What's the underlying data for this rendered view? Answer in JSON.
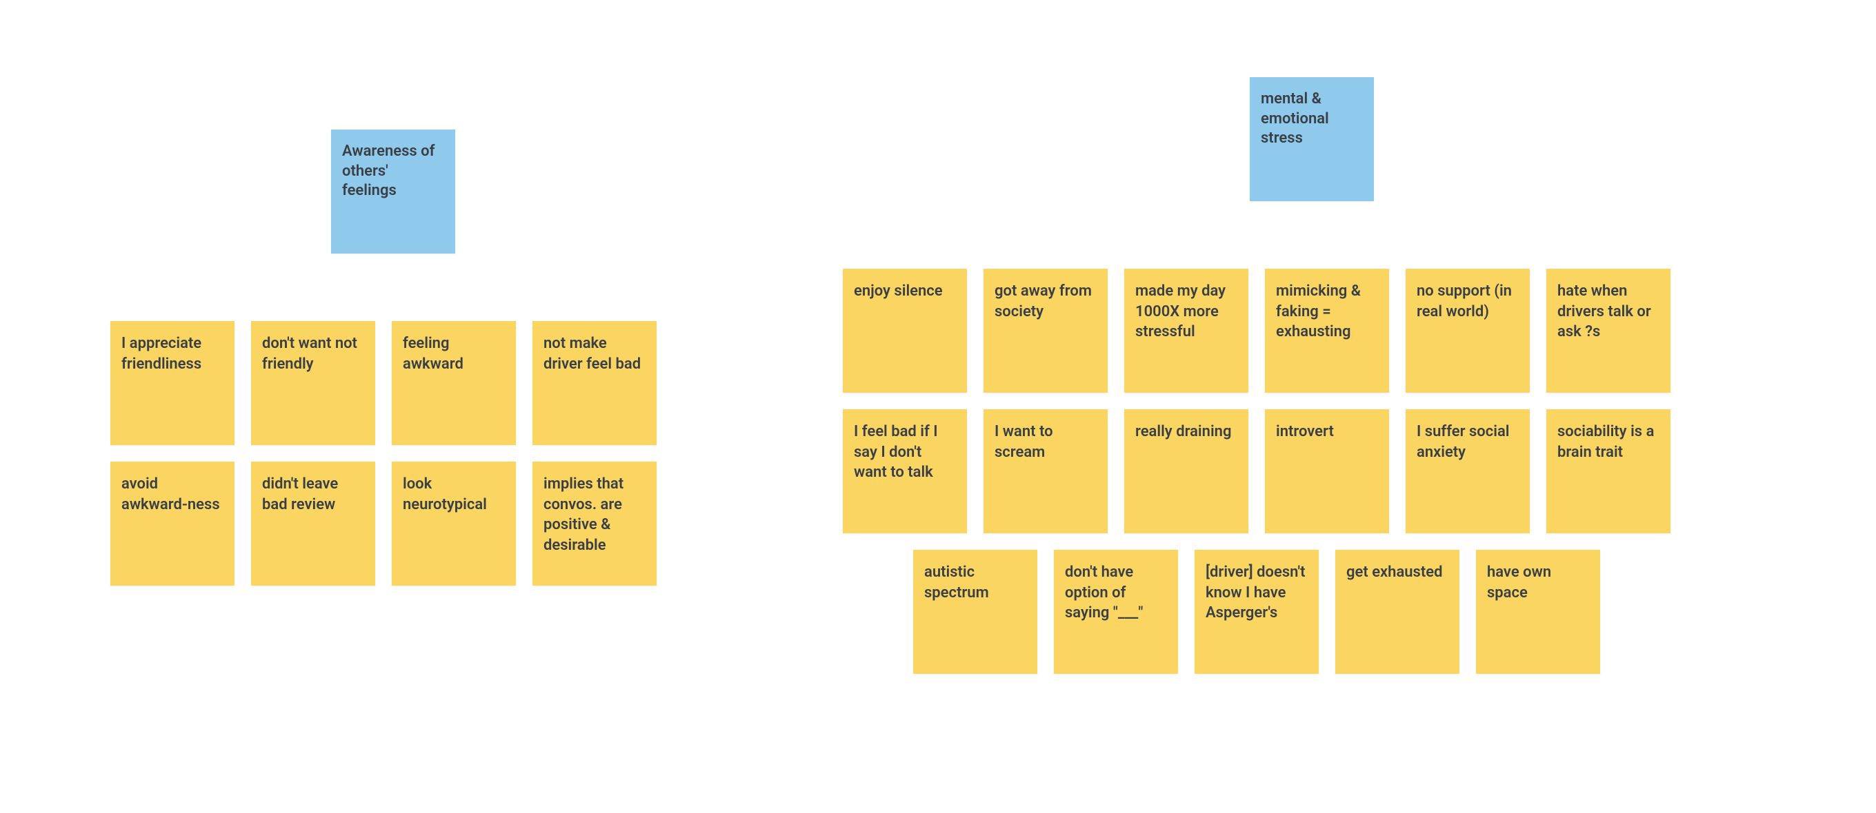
{
  "colors": {
    "header": "#8fc9eb",
    "note": "#fad561",
    "text": "#3a3f46",
    "background": "#ffffff"
  },
  "clusters": [
    {
      "id": "awareness",
      "header": "Awareness of others' feelings",
      "rows": [
        [
          "I appreciate friendliness",
          "don't want not friendly",
          "feeling awkward",
          "not make driver feel bad"
        ],
        [
          "avoid awkward-ness",
          "didn't leave bad review",
          "look neurotypical",
          "implies that convos. are positive & desirable"
        ]
      ]
    },
    {
      "id": "stress",
      "header": "mental & emotional stress",
      "rows": [
        [
          "enjoy silence",
          "got away from society",
          "made my day 1000X more stressful",
          "mimicking & faking = exhausting",
          "no support (in real world)",
          "hate when drivers talk or ask ?s"
        ],
        [
          "I feel bad if I say I don't want to talk",
          "I want to scream",
          "really draining",
          "introvert",
          "I suffer social anxiety",
          "sociability is a brain trait"
        ],
        [
          "autistic spectrum",
          "don't have option of saying \"___\"",
          "[driver] doesn't know I have Asperger's",
          "get exhausted",
          "have own space"
        ]
      ]
    }
  ]
}
